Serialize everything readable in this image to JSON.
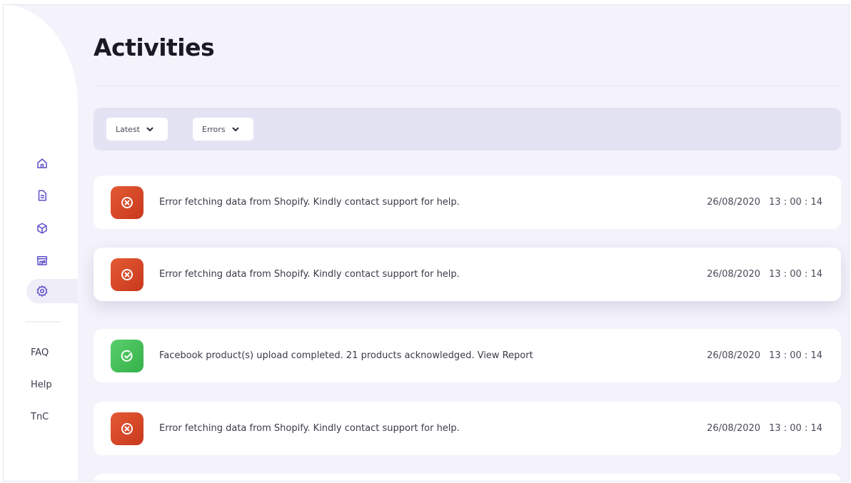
{
  "page": {
    "title": "Activities"
  },
  "sidebar": {
    "nav_icons": [
      "home-icon",
      "document-icon",
      "cube-icon",
      "store-icon",
      "gear-icon"
    ],
    "active_item": "gear-icon",
    "links": [
      "FAQ",
      "Help",
      "TnC"
    ]
  },
  "filters": {
    "sort": {
      "label": "Latest"
    },
    "type": {
      "label": "Errors"
    }
  },
  "activities": [
    {
      "status": "error",
      "message": "Error fetching data from Shopify. Kindly contact support for help.",
      "date": "26/08/2020",
      "time": "13 : 00 : 14"
    },
    {
      "status": "error",
      "message": "Error fetching data from Shopify. Kindly contact support for help.",
      "date": "26/08/2020",
      "time": "13 : 00 : 14"
    },
    {
      "status": "success",
      "message": "Facebook product(s) upload completed. 21 products acknowledged. View Report",
      "date": "26/08/2020",
      "time": "13 : 00 : 14"
    },
    {
      "status": "error",
      "message": "Error fetching data from Shopify. Kindly contact support for help.",
      "date": "26/08/2020",
      "time": "13 : 00 : 14"
    }
  ],
  "colors": {
    "accent": "#5b4fc9",
    "error": "#d8482a",
    "success": "#45c05a",
    "background": "#f4f3fb",
    "filter_bar": "#e4e3f4"
  }
}
